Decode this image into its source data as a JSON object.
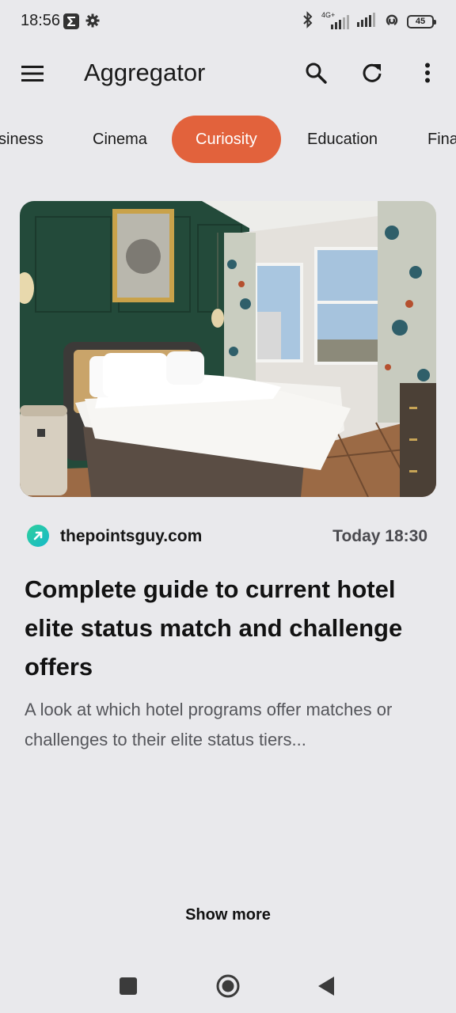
{
  "status_bar": {
    "time": "18:56",
    "network_label": "4G+",
    "battery": "45",
    "icons": [
      "sigma-app-icon",
      "settings-gear-icon",
      "bluetooth-icon",
      "signal-4g-icon",
      "signal-icon",
      "hotspot-icon",
      "battery-icon"
    ]
  },
  "app_bar": {
    "title": "Aggregator",
    "icons": [
      "menu-icon",
      "search-icon",
      "refresh-icon",
      "more-vert-icon"
    ]
  },
  "tabs": [
    {
      "label": "Business",
      "visible_text": "siness",
      "active": false
    },
    {
      "label": "Cinema",
      "active": false
    },
    {
      "label": "Curiosity",
      "active": true
    },
    {
      "label": "Education",
      "active": false
    },
    {
      "label": "Finance",
      "visible_text": "Fina",
      "active": false
    }
  ],
  "article": {
    "source": "thepointsguy.com",
    "time": "Today 18:30",
    "title": "Complete guide to current hotel elite status match and challenge offers",
    "summary": "A look at which hotel programs offer matches or challenges to their elite status tiers..."
  },
  "show_more_label": "Show more",
  "nav_bar": {
    "icons": [
      "recents-square-icon",
      "home-circle-icon",
      "back-triangle-icon"
    ]
  },
  "colors": {
    "accent": "#e2623c",
    "background": "#e9e9ec",
    "source_logo": "#2fcf9c"
  }
}
